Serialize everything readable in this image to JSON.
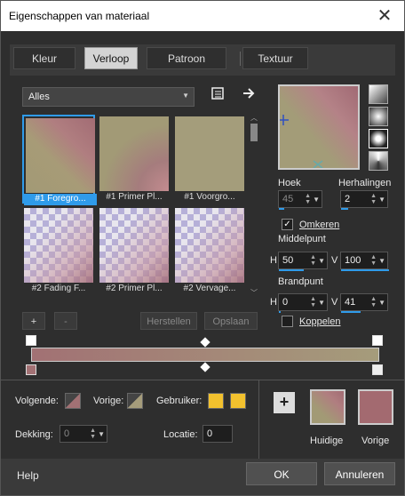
{
  "window": {
    "title": "Eigenschappen van materiaal",
    "close": "✕"
  },
  "tabs": [
    {
      "label": "Kleur"
    },
    {
      "label": "Verloop"
    },
    {
      "label": "Patroon"
    },
    {
      "label": "Textuur"
    }
  ],
  "category": {
    "value": "Alles"
  },
  "thumbnails": [
    {
      "caption": "#1 Foregro..."
    },
    {
      "caption": "#1 Primer Pl..."
    },
    {
      "caption": "#1 Voorgro..."
    },
    {
      "caption": "#2 Fading F..."
    },
    {
      "caption": "#2 Primer Pl..."
    },
    {
      "caption": "#2 Vervage..."
    }
  ],
  "buttons": {
    "add": "+",
    "remove": "-",
    "reset": "Herstellen",
    "save": "Opslaan",
    "ok": "OK",
    "cancel": "Annuleren",
    "help": "Help"
  },
  "angle": {
    "label": "Hoek",
    "value": "45"
  },
  "repeats": {
    "label": "Herhalingen",
    "value": "2"
  },
  "invert": {
    "label": "Omkeren",
    "checked": true
  },
  "center": {
    "label": "Middelpunt",
    "h_label": "H",
    "h": "50",
    "v_label": "V",
    "v": "100"
  },
  "focal": {
    "label": "Brandpunt",
    "h_label": "H",
    "h": "0",
    "v_label": "V",
    "v": "41"
  },
  "link": {
    "label": "Koppelen",
    "checked": false
  },
  "bottom": {
    "next_label": "Volgende:",
    "prev_label": "Vorige:",
    "user_label": "Gebruiker:",
    "opacity_label": "Dekking:",
    "opacity_value": "0",
    "location_label": "Locatie:",
    "location_value": "0",
    "current_label": "Huidige",
    "previous_label": "Vorige"
  },
  "colors": {
    "accent": "#2f9bea",
    "user": "#f2c12e",
    "prev_swatch": "#a36a70",
    "gradient_start": "#a27174",
    "gradient_end": "#a59c7b"
  }
}
